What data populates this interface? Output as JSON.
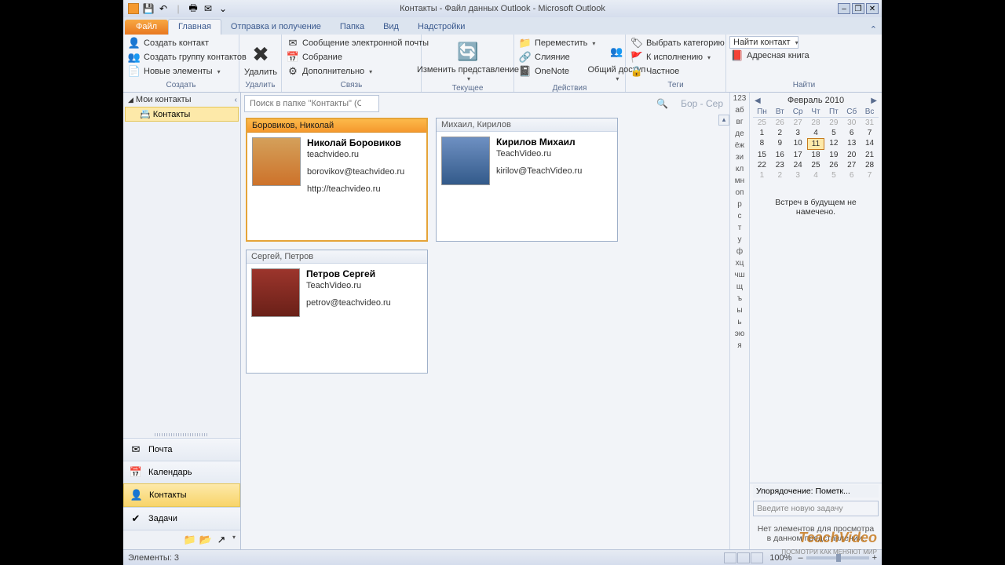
{
  "title": "Контакты - Файл данных Outlook  - Microsoft Outlook",
  "tabs": {
    "file": "Файл",
    "home": "Главная",
    "sendrecv": "Отправка и получение",
    "folder": "Папка",
    "view": "Вид",
    "addins": "Надстройки"
  },
  "ribbon": {
    "create": {
      "new_contact": "Создать контакт",
      "new_group": "Создать группу контактов",
      "new_items": "Новые элементы",
      "label": "Создать"
    },
    "delete": {
      "btn": "Удалить",
      "label": "Удалить"
    },
    "link": {
      "email": "Сообщение электронной почты",
      "meeting": "Собрание",
      "more": "Дополнительно",
      "label": "Связь"
    },
    "view": {
      "change": "Изменить представление",
      "label": "Текущее представление"
    },
    "actions": {
      "move": "Переместить",
      "merge": "Слияние",
      "onenote": "OneNote",
      "share": "Общий доступ",
      "label": "Действия"
    },
    "tags": {
      "category": "Выбрать категорию",
      "followup": "К исполнению",
      "private": "Частное",
      "label": "Теги"
    },
    "find": {
      "find_contact": "Найти контакт",
      "address_book": "Адресная книга",
      "label": "Найти"
    }
  },
  "nav": {
    "header": "Мои контакты",
    "item": "Контакты",
    "mail": "Почта",
    "calendar": "Календарь",
    "contacts": "Контакты",
    "tasks": "Задачи"
  },
  "search": {
    "placeholder": "Поиск в папке \"Контакты\" (CTRL+У)",
    "range": "Бор - Сер"
  },
  "cards": [
    {
      "header": "Боровиков, Николай",
      "name": "Николай Боровиков",
      "company": "teachvideo.ru",
      "email": "borovikov@teachvideo.ru",
      "web": "http://teachvideo.ru",
      "selected": true
    },
    {
      "header": "Михаил, Кирилов",
      "name": "Кирилов Михаил",
      "company": "TeachVideo.ru",
      "email": "kirilov@TeachVideo.ru",
      "web": "",
      "selected": false
    },
    {
      "header": "Сергей, Петров",
      "name": "Петров Сергей",
      "company": "TeachVideo.ru",
      "email": "petrov@teachvideo.ru",
      "web": "",
      "selected": false
    }
  ],
  "alpha": [
    "123",
    "аб",
    "вг",
    "де",
    "ёж",
    "зи",
    "кл",
    "мн",
    "оп",
    "р",
    "с",
    "т",
    "у",
    "ф",
    "хц",
    "чш",
    "щ",
    "ъ",
    "ы",
    "ь",
    "эю",
    "я"
  ],
  "calendar": {
    "title": "Февраль 2010",
    "dow": [
      "Пн",
      "Вт",
      "Ср",
      "Чт",
      "Пт",
      "Сб",
      "Вс"
    ],
    "prev": [
      25,
      26,
      27,
      28,
      29,
      30,
      31
    ],
    "days": [
      1,
      2,
      3,
      4,
      5,
      6,
      7,
      8,
      9,
      10,
      11,
      12,
      13,
      14,
      15,
      16,
      17,
      18,
      19,
      20,
      21,
      22,
      23,
      24,
      25,
      26,
      27,
      28
    ],
    "next": [
      1,
      2,
      3,
      4,
      5,
      6,
      7
    ],
    "today": 11,
    "no_appt": "Встреч в будущем не намечено."
  },
  "tasks": {
    "sort": "Упорядочение: Пометк...",
    "new_placeholder": "Введите новую задачу",
    "empty": "Нет элементов для просмотра в данном представлении."
  },
  "status": {
    "count": "Элементы: 3",
    "zoom": "100%"
  },
  "watermark": "TeachVideo",
  "watermark_sub": "ПОСМОТРИ КАК МЕНЯЮТ МИР"
}
